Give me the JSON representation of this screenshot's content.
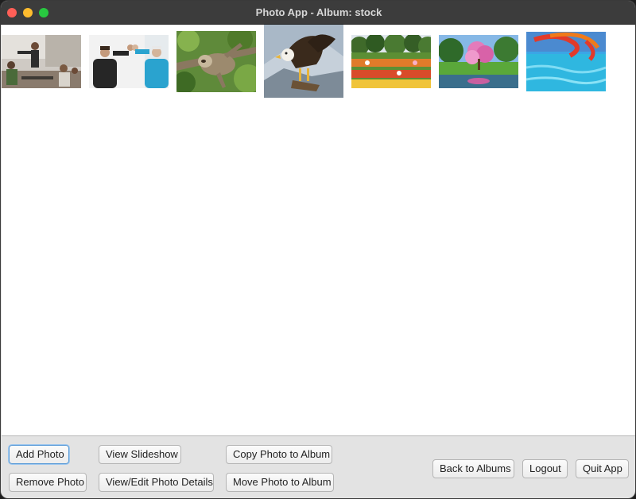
{
  "window": {
    "title": "Photo App - Album: stock"
  },
  "photos": [
    {
      "name": "photo-meeting",
      "icon": "meeting-photo"
    },
    {
      "name": "photo-high-five",
      "icon": "high-five-photo"
    },
    {
      "name": "photo-sloth",
      "icon": "sloth-photo"
    },
    {
      "name": "photo-eagle",
      "icon": "eagle-photo"
    },
    {
      "name": "photo-flower-garden",
      "icon": "garden-photo"
    },
    {
      "name": "photo-blossom-tree",
      "icon": "tree-photo"
    },
    {
      "name": "photo-water-park",
      "icon": "waterpark-photo"
    }
  ],
  "buttons": {
    "add_photo": "Add Photo",
    "remove_photo": "Remove Photo",
    "view_slideshow": "View Slideshow",
    "view_edit_details": "View/Edit Photo Details",
    "copy_to_album": "Copy Photo to Album",
    "move_to_album": "Move Photo to Album",
    "back_to_albums": "Back to Albums",
    "logout": "Logout",
    "quit_app": "Quit App"
  },
  "colors": {
    "titlebar": "#3c3c3c",
    "close": "#ff5f57",
    "minimize": "#febc2e",
    "maximize": "#28c840",
    "focus_ring": "#5a9bd8"
  }
}
